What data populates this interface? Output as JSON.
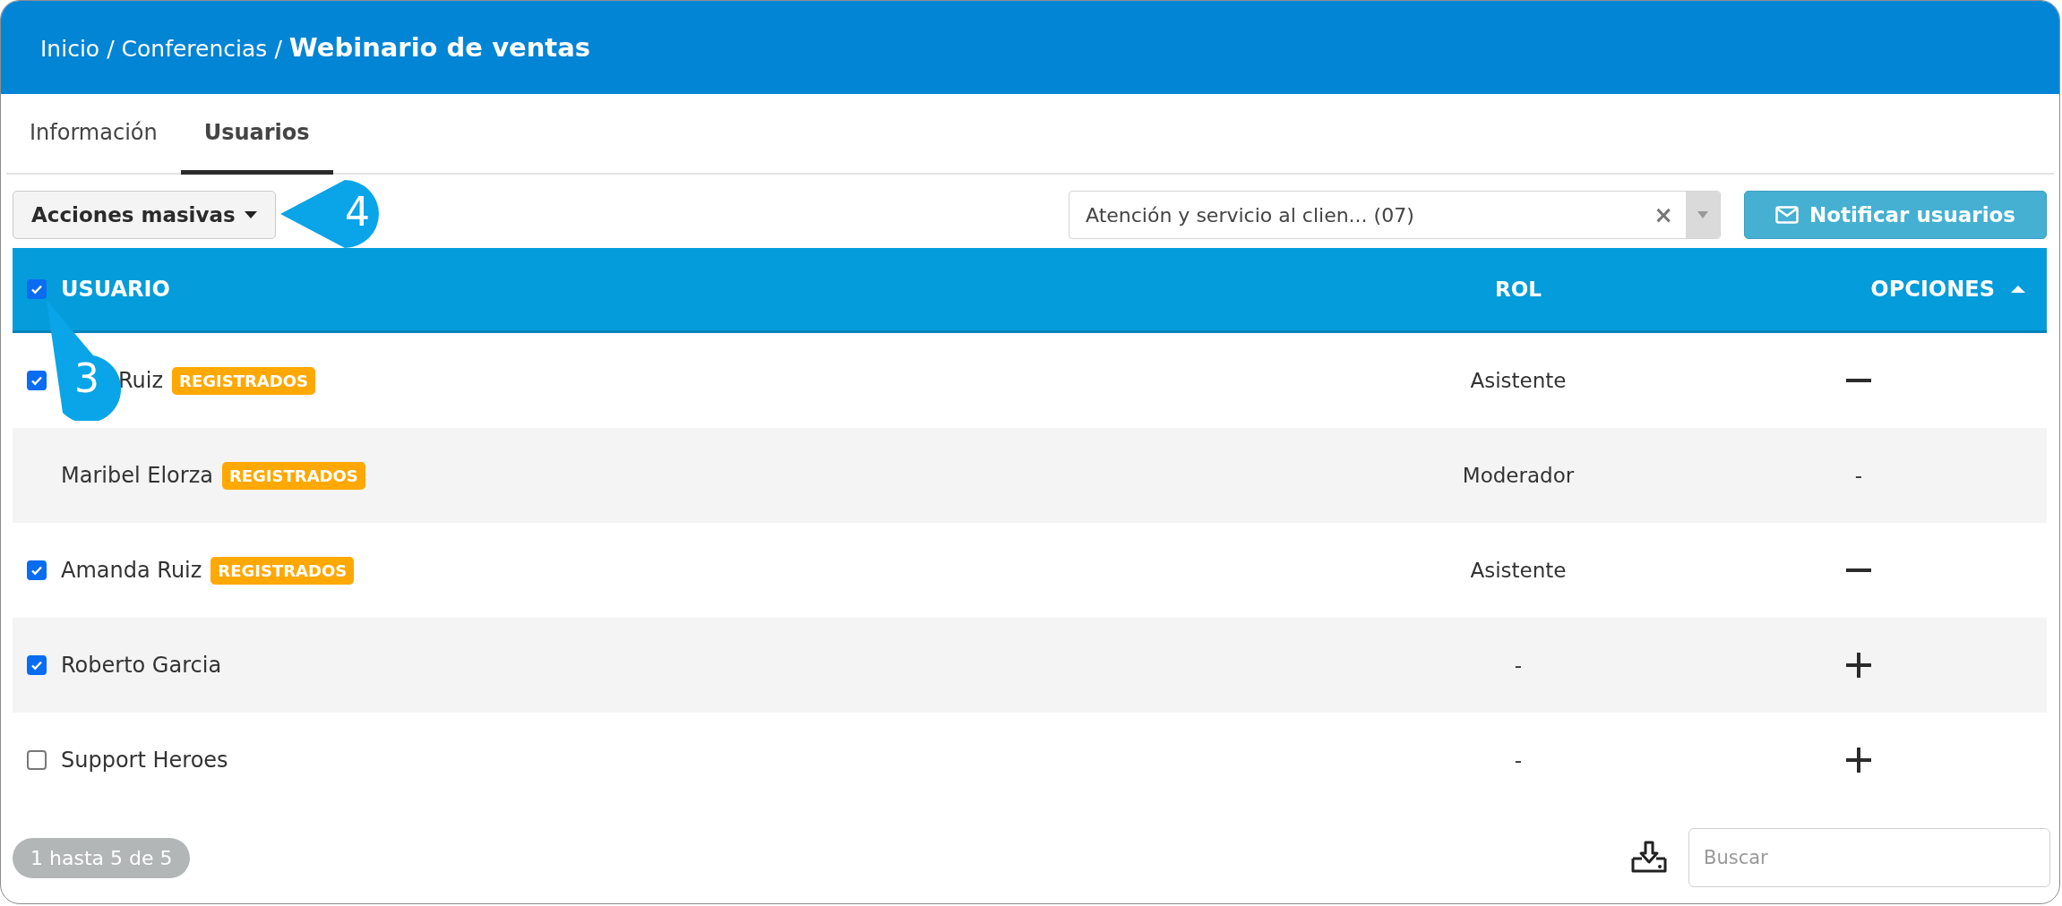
{
  "breadcrumb": {
    "items": [
      "Inicio",
      "Conferencias"
    ],
    "separator": "/",
    "current": "Webinario de ventas"
  },
  "tabs": [
    {
      "label": "Información",
      "selected": false
    },
    {
      "label": "Usuarios",
      "selected": true
    }
  ],
  "toolbar": {
    "bulk_actions": "Acciones masivas",
    "filter": {
      "value": "Atención y servicio al clien... (07)",
      "clear": "×"
    },
    "notify_button": "Notificar usuarios"
  },
  "callouts": [
    {
      "number": "4"
    }
  ],
  "table": {
    "select_all_checked": true,
    "columns": [
      {
        "label": "USUARIO"
      },
      {
        "label": "ROL"
      },
      {
        "label": "OPCIONES",
        "sorted_ascending": true
      }
    ],
    "rows": [
      {
        "callout": "3",
        "name": "Ruiz",
        "badge": "REGISTRADOS",
        "role": "Asistente",
        "option": {
          "kind": "minus"
        },
        "checked": true
      },
      {
        "name": "Maribel Elorza",
        "badge": "REGISTRADOS",
        "role": "Moderador",
        "option": {
          "kind": "text",
          "text": "-"
        }
      },
      {
        "name": "Amanda Ruiz",
        "badge": "REGISTRADOS",
        "role": "Asistente",
        "option": {
          "kind": "minus"
        },
        "checked": true
      },
      {
        "name": "Roberto Garcia",
        "role": "-",
        "option": {
          "kind": "plus"
        },
        "checked": true
      },
      {
        "name": "Support Heroes",
        "role": "-",
        "option": {
          "kind": "plus"
        },
        "checked": false
      }
    ]
  },
  "footer": {
    "page_info": "1 hasta 5 de 5",
    "search": {
      "placeholder": "Buscar"
    }
  }
}
